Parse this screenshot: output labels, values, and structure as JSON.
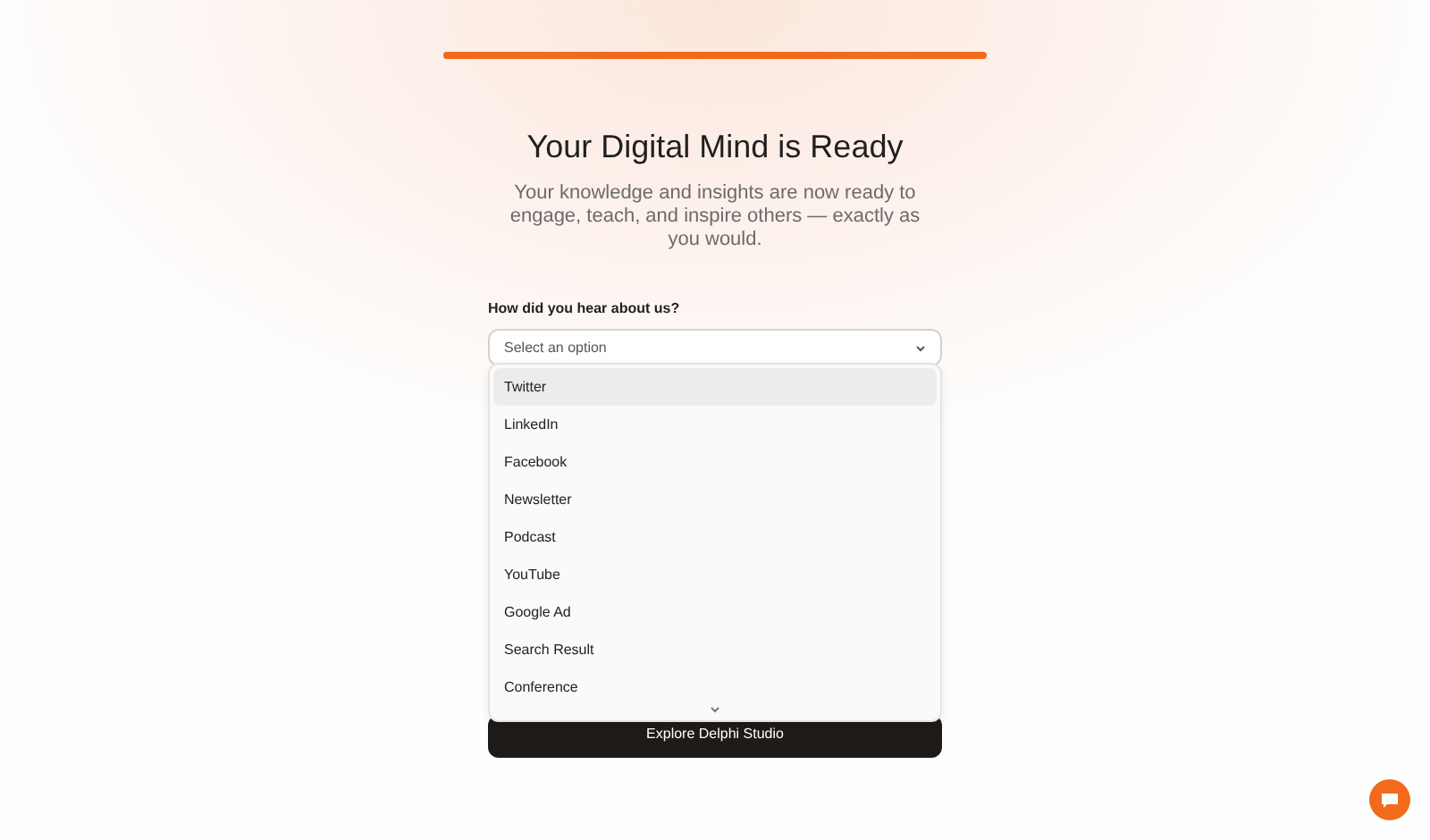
{
  "progress": {
    "level": 1
  },
  "title": "Your Digital Mind is Ready",
  "subtitle": "Your knowledge and insights are now ready to engage, teach, and inspire others — exactly as you would.",
  "field": {
    "label": "How did you hear about us?",
    "placeholder": "Select an option",
    "expanded": true
  },
  "options": [
    {
      "label": "Twitter",
      "selected": true
    },
    {
      "label": "LinkedIn",
      "selected": false
    },
    {
      "label": "Facebook",
      "selected": false
    },
    {
      "label": "Newsletter",
      "selected": false
    },
    {
      "label": "Podcast",
      "selected": false
    },
    {
      "label": "YouTube",
      "selected": false
    },
    {
      "label": "Google Ad",
      "selected": false
    },
    {
      "label": "Search Result",
      "selected": false
    },
    {
      "label": "Conference",
      "selected": false
    }
  ],
  "primary_button": "Explore Delphi Studio"
}
